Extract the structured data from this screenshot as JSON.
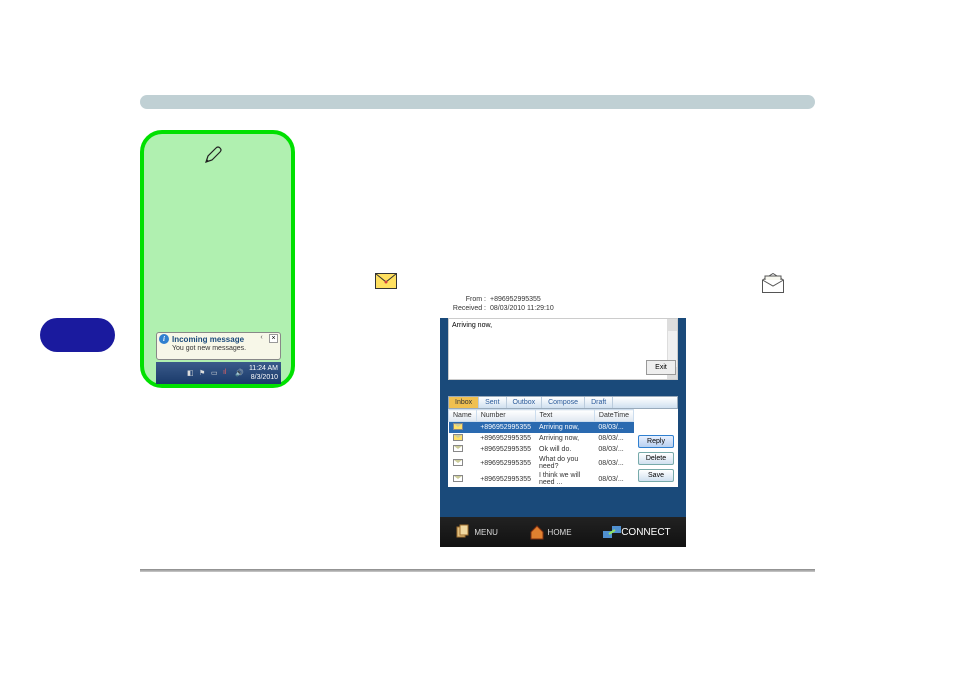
{
  "notification": {
    "title": "Incoming message",
    "body": "You got new messages."
  },
  "taskbar": {
    "time": "11:24 AM",
    "date": "8/3/2010"
  },
  "sms": {
    "from_label": "From :",
    "from_value": "+896952995355",
    "received_label": "Received :",
    "received_value": "08/03/2010 11:29:10",
    "body": "Arriving now,",
    "exit_label": "Exit",
    "tabs": [
      "Inbox",
      "Sent",
      "Outbox",
      "Compose",
      "Draft"
    ],
    "active_tab": 0,
    "columns": [
      "Name",
      "Number",
      "Text",
      "DateTime"
    ],
    "rows": [
      {
        "icon": "unread",
        "name": "",
        "number": "+896952995355",
        "text": "Arriving now,",
        "datetime": "08/03/...",
        "selected": true
      },
      {
        "icon": "unread",
        "name": "",
        "number": "+896952995355",
        "text": "Arriving now,",
        "datetime": "08/03/...",
        "selected": false
      },
      {
        "icon": "read",
        "name": "",
        "number": "+896952995355",
        "text": "Ok will do.",
        "datetime": "08/03/...",
        "selected": false
      },
      {
        "icon": "read",
        "name": "",
        "number": "+896952995355",
        "text": "What do you need?",
        "datetime": "08/03/...",
        "selected": false
      },
      {
        "icon": "read",
        "name": "",
        "number": "+896952995355",
        "text": "I think we will need ...",
        "datetime": "08/03/...",
        "selected": false
      }
    ],
    "buttons": {
      "reply": "Reply",
      "delete": "Delete",
      "save": "Save"
    },
    "bottom": {
      "menu": "MENU",
      "home": "HOME",
      "connect": "CONNECT"
    }
  }
}
